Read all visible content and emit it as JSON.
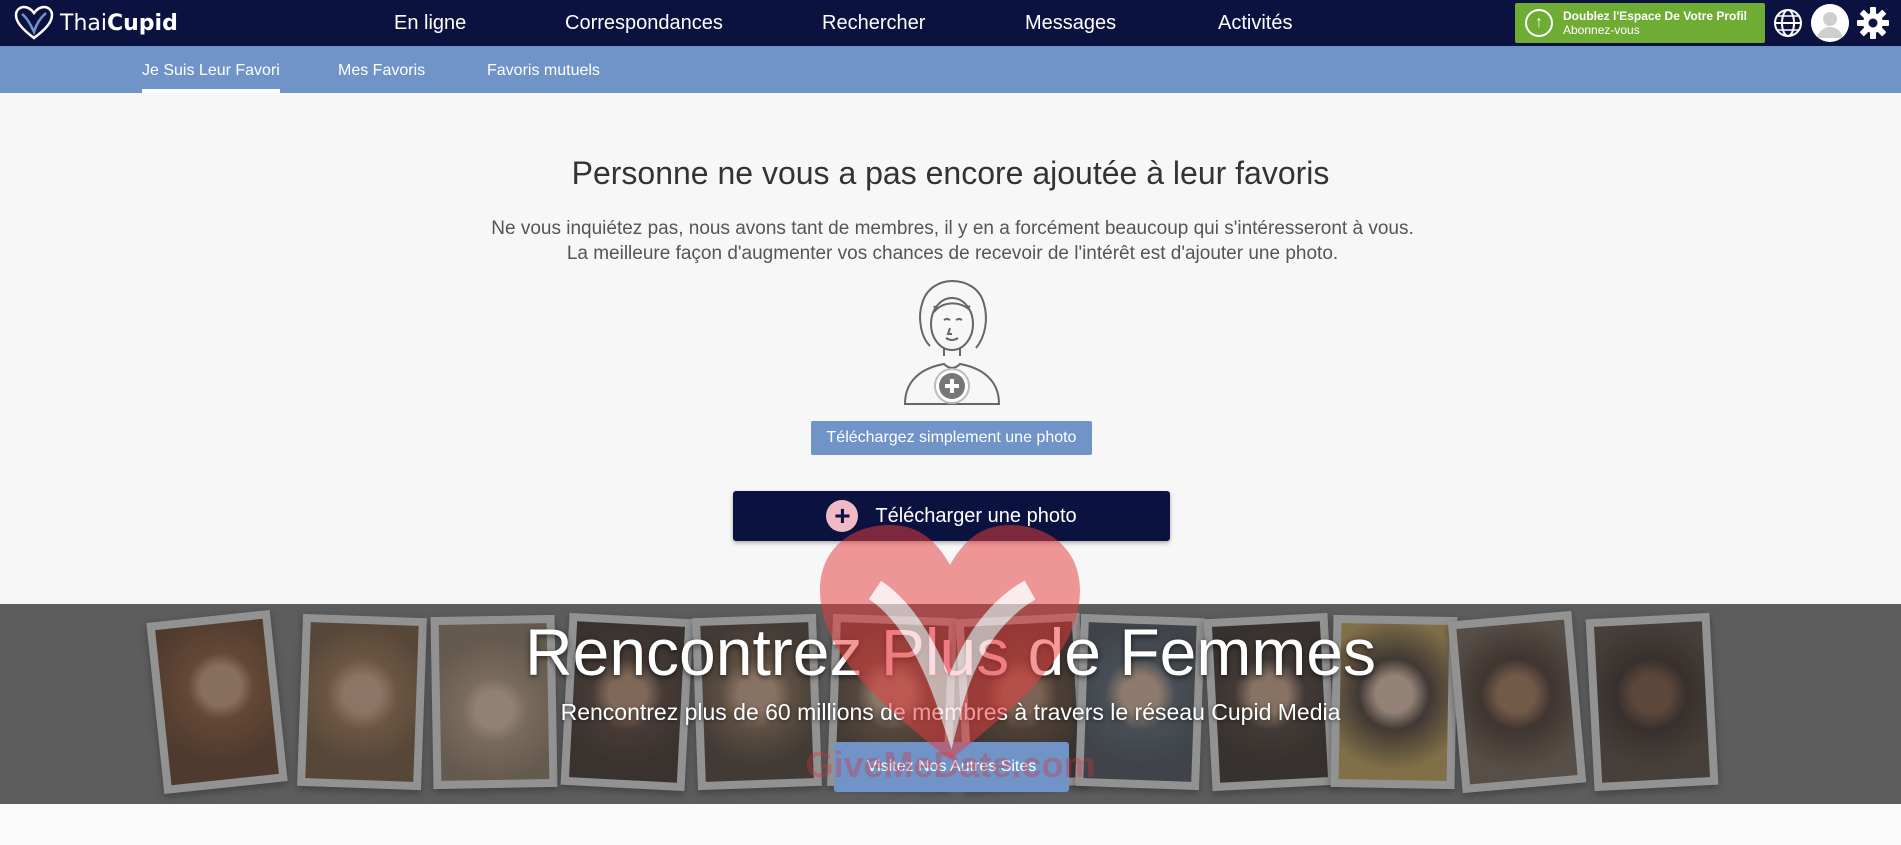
{
  "logo": {
    "part1": "Thai",
    "part2": "Cupid"
  },
  "nav": {
    "items": [
      {
        "label": "En ligne"
      },
      {
        "label": "Correspondances"
      },
      {
        "label": "Rechercher"
      },
      {
        "label": "Messages"
      },
      {
        "label": "Activités"
      }
    ]
  },
  "upgrade": {
    "title": "Doublez l'Espace De Votre Profil",
    "subtitle": "Abonnez-vous"
  },
  "icons": {
    "globe": "globe-icon",
    "avatar": "avatar-icon",
    "settings": "gear-icon",
    "upload": "plus-icon"
  },
  "subnav": {
    "tabs": [
      {
        "label": "Je Suis Leur Favori",
        "active": true
      },
      {
        "label": "Mes Favoris",
        "active": false
      },
      {
        "label": "Favoris mutuels",
        "active": false
      }
    ]
  },
  "main": {
    "title": "Personne ne vous a pas encore ajoutée à leur favoris",
    "description": "Ne vous inquiétez pas, nous avons tant de membres, il y en a forcément beaucoup qui s'intéresseront à vous. La meilleure façon d'augmenter vos chances de recevoir de l'intérêt est d'ajouter une photo.",
    "upload_small_label": "Téléchargez simplement une photo",
    "upload_big_label": "Télécharger une photo"
  },
  "banner": {
    "title_part1": "Rencontrez ",
    "title_highlight": "Plus",
    "title_part2": " de Femmes",
    "subtitle": "Rencontrez plus de 60 millions de membres à travers le réseau Cupid Media",
    "button_label": "Visitez Nos Autres Sites",
    "watermark": "GiveMeDate.com"
  },
  "colors": {
    "navy": "#0c1240",
    "nav_blue": "#7094c8",
    "upgrade_green": "#6fac34",
    "accent_pink": "#f0b9c6"
  }
}
